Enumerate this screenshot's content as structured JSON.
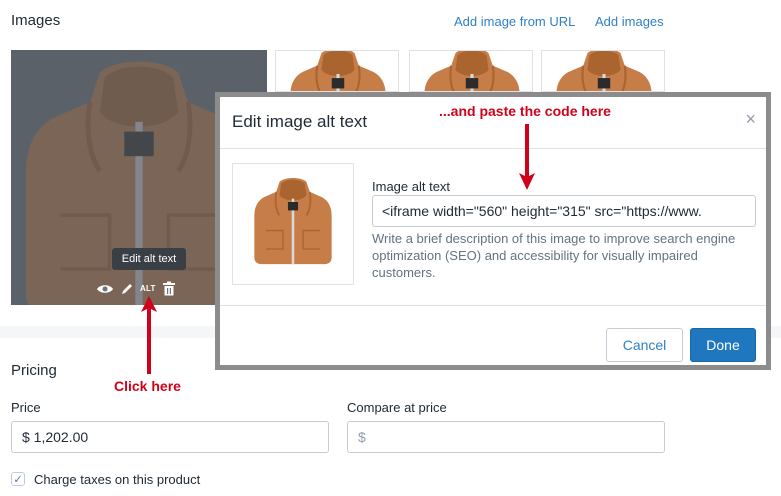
{
  "images_section": {
    "title": "Images",
    "add_from_url": "Add image from URL",
    "add_images": "Add images",
    "tooltip": "Edit alt text",
    "alt_icon_label": "ALT"
  },
  "annotations": {
    "paste_here": "...and paste the code here",
    "click_here": "Click here",
    "color": "#d0021b"
  },
  "modal": {
    "title": "Edit image alt text",
    "close": "×",
    "field_label": "Image alt text",
    "field_value": "<iframe width=\"560\" height=\"315\" src=\"https://www.",
    "help_text": "Write a brief description of this image to improve search engine optimization (SEO) and accessibility for visually impaired customers.",
    "cancel_label": "Cancel",
    "done_label": "Done"
  },
  "pricing": {
    "title": "Pricing",
    "price_label": "Price",
    "price_value": "$ 1,202.00",
    "compare_label": "Compare at price",
    "compare_placeholder": "$",
    "charge_taxes_label": "Charge taxes on this product",
    "charge_taxes_checked": true
  },
  "colors": {
    "link": "#2f80c4",
    "primary_button": "#1f77c0",
    "hoodie": "#c67d47"
  },
  "icons": [
    "eye-icon",
    "pencil-icon",
    "alt-icon",
    "trash-icon",
    "close-icon",
    "checkmark-icon",
    "arrow-icon"
  ]
}
